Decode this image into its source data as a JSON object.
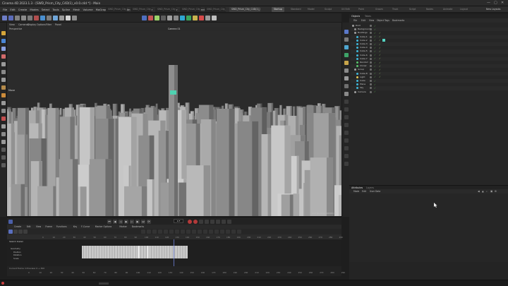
{
  "window": {
    "title": "Cinema 4D 2023.1.3 - [SWD_Prism_City_C4D(1)_v0.0.c4d *] - Main",
    "controls": [
      "—",
      "▢",
      "✕"
    ]
  },
  "menubar": {
    "items": [
      "File",
      "Edit",
      "Create",
      "Modes",
      "Select",
      "Tools",
      "Spline",
      "Mesh",
      "Volume",
      "MoGraph",
      "Character",
      "Animate",
      "Simulate",
      "Tracker",
      "Render",
      "Extensions",
      "Window",
      "Help"
    ],
    "file_tabs": [
      "SWD_Prism_City_C4D(1)…",
      "SWD_Prism_City_C4D(1)…",
      "SWD_Prism_City_C4D(1)…",
      "SWD_Prism_City_C4D(1)…",
      "SWD_Prism_City_C4D(1)…",
      "SWD_Prism_City_C4D(1)_v0.0.c4d *"
    ],
    "active_file_tab": 5,
    "layouts": [
      "Startup",
      "Standard",
      "Model",
      "Sculpt",
      "UV Edit",
      "Paint",
      "Groom",
      "Track",
      "Script",
      "Nodes",
      "Animate",
      "Layout"
    ],
    "active_layout": 0,
    "new_layouts_label": "New Layouts"
  },
  "viewport": {
    "menu": [
      "View",
      "Cameras",
      "Display",
      "Options",
      "Filter",
      "Panel"
    ],
    "label": "Perspective",
    "camera": "Camera 01",
    "move_label": "Move",
    "grid_spacing": "Grid Spacing : 10000 cm"
  },
  "object_manager": {
    "tabs": [
      "Objects",
      "Takes"
    ],
    "menu": [
      "File",
      "Edit",
      "View",
      "Object",
      "Tags",
      "Bookmarks"
    ],
    "objects": [
      {
        "name": "Root",
        "color": "#a0a0a0",
        "indent": 0
      },
      {
        "name": "Background",
        "color": "#8f8f8f",
        "indent": 1
      },
      {
        "name": "Buildings",
        "color": "#a0a0a0",
        "indent": 1
      },
      {
        "name": "Cube.1",
        "color": "#3fb7d9",
        "indent": 2
      },
      {
        "name": "Cube.2",
        "color": "#3fb7d9",
        "indent": 2
      },
      {
        "name": "Cube.3",
        "color": "#3fb7d9",
        "indent": 2
      },
      {
        "name": "Cube.4",
        "color": "#3fb7d9",
        "indent": 2
      },
      {
        "name": "Cube.5",
        "color": "#3fb7d9",
        "indent": 2
      },
      {
        "name": "Cube.6",
        "color": "#3fb7d9",
        "indent": 2
      },
      {
        "name": "Cube.7",
        "color": "#3fb7d9",
        "indent": 2
      },
      {
        "name": "Random",
        "color": "#58c46b",
        "indent": 2
      },
      {
        "name": "Cloner",
        "color": "#58c46b",
        "indent": 2
      },
      {
        "name": "Group",
        "color": "#a0a0a0",
        "indent": 1
      },
      {
        "name": "Cube.8",
        "color": "#3fb7d9",
        "indent": 2
      },
      {
        "name": "Light",
        "color": "#e3c857",
        "indent": 2
      },
      {
        "name": "Cube",
        "color": "#3fb7d9",
        "indent": 2
      },
      {
        "name": "Plane",
        "color": "#3fb7d9",
        "indent": 2
      },
      {
        "name": "Sky",
        "color": "#3fb7d9",
        "indent": 2
      },
      {
        "name": "Camera",
        "color": "#a0a0a0",
        "indent": 1
      }
    ]
  },
  "attributes": {
    "tabs": [
      "Attributes",
      "Layers"
    ],
    "menu": [
      "Mode",
      "Edit",
      "User Data"
    ]
  },
  "timeline": {
    "current_frame": "0 F",
    "menu": [
      "Create",
      "Edit",
      "View",
      "Frame",
      "Functions",
      "Key",
      "F-Curve",
      "Marker Options",
      "Marker",
      "Bookmarks"
    ],
    "ruler_ticks": [
      "0",
      "10",
      "20",
      "30",
      "40",
      "50",
      "60",
      "70",
      "80",
      "90",
      "100",
      "110",
      "120",
      "130",
      "140",
      "150",
      "160",
      "170",
      "180",
      "190",
      "200",
      "210",
      "220",
      "230",
      "240",
      "250",
      "260",
      "270",
      "280",
      "290"
    ],
    "tracks_title": "Sketch Detail",
    "tracks": [
      "Geometry",
      "Position",
      "Rotation",
      "Scale"
    ],
    "bottom_label": "Current Frame: 0  Preview: 0 → 300",
    "bottom_ticks": [
      "0",
      "10",
      "20",
      "30",
      "40",
      "50",
      "60",
      "70",
      "80",
      "90",
      "100",
      "110",
      "120",
      "130",
      "140",
      "150",
      "160",
      "170",
      "180",
      "190",
      "200",
      "210",
      "220",
      "230",
      "240",
      "250",
      "260",
      "270",
      "280",
      "290"
    ]
  }
}
